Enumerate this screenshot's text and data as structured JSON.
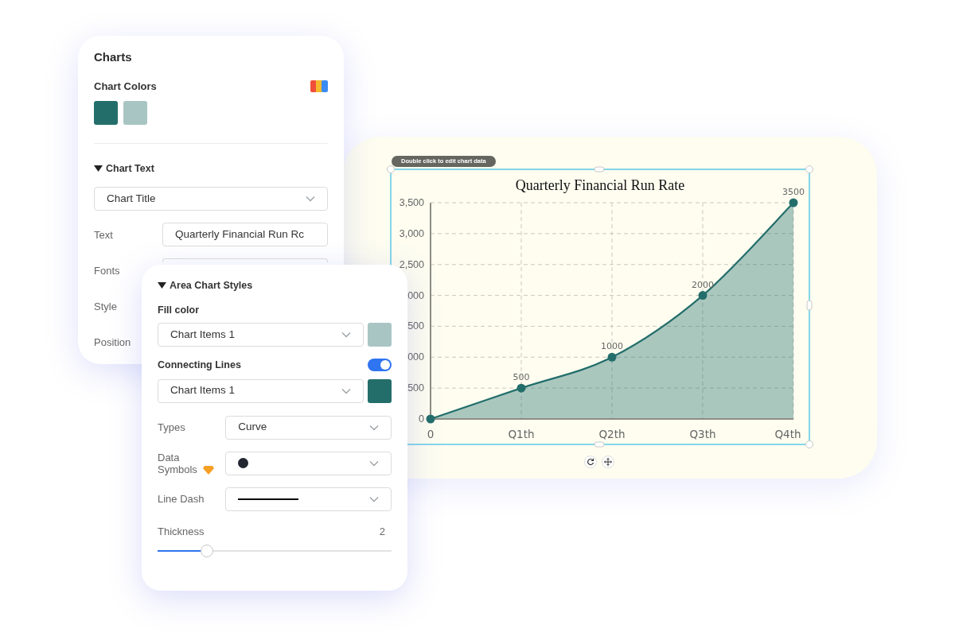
{
  "charts_panel": {
    "title": "Charts",
    "chart_colors": {
      "label": "Chart Colors",
      "swatches": [
        {
          "color": "#236e6b"
        },
        {
          "color": "#a8c5c3"
        }
      ]
    },
    "chart_text": {
      "label": "Chart Text",
      "expanded": true,
      "element_select": "Chart Title",
      "rows": [
        {
          "kind": "input",
          "label": "Text",
          "value": "Quarterly Financial Run Rc"
        },
        {
          "kind": "covered_input",
          "label": "Fonts"
        },
        {
          "kind": "hidden",
          "label": "Style"
        },
        {
          "kind": "hidden",
          "label": "Position"
        }
      ]
    }
  },
  "styles_panel": {
    "title": "Area Chart Styles",
    "expanded": true,
    "fill_color": {
      "label": "Fill color",
      "select": "Chart Items 1",
      "color": "#a8c5c3"
    },
    "connecting_lines": {
      "label": "Connecting Lines",
      "on": true,
      "select": "Chart Items 1",
      "color": "#236e6b"
    },
    "rows": [
      {
        "kind": "text",
        "label": "Types",
        "value": "Curve"
      },
      {
        "kind": "symbol",
        "label": "Data Symbols"
      },
      {
        "kind": "dash",
        "label": "Line Dash"
      }
    ],
    "thickness": {
      "label": "Thickness",
      "reading": "2",
      "level": 0.21
    }
  },
  "chart": {
    "hint": "Double click to edit chart data",
    "chart_data": {
      "type": "area",
      "title": "Quarterly Financial Run Rate",
      "categories": [
        "0",
        "Q1th",
        "Q2th",
        "Q3th",
        "Q4th"
      ],
      "series": [
        {
          "color": "#236e6b",
          "values": [
            0,
            500,
            1000,
            2000,
            3500
          ]
        }
      ],
      "ylim": [
        0,
        3500
      ],
      "yticks": [
        {
          "value": 0,
          "label": "0"
        },
        {
          "value": 500,
          "label": "500"
        },
        {
          "value": 2500,
          "label": "2,500"
        },
        {
          "value": 3000,
          "label": "3,000"
        },
        {
          "value": 3500,
          "label": "3,500"
        }
      ],
      "grid": true,
      "value_labels": [
        null,
        "500",
        "1000",
        "2000",
        "3500"
      ]
    },
    "y_axis_label_fragments": [
      "000",
      "500",
      "000"
    ]
  }
}
